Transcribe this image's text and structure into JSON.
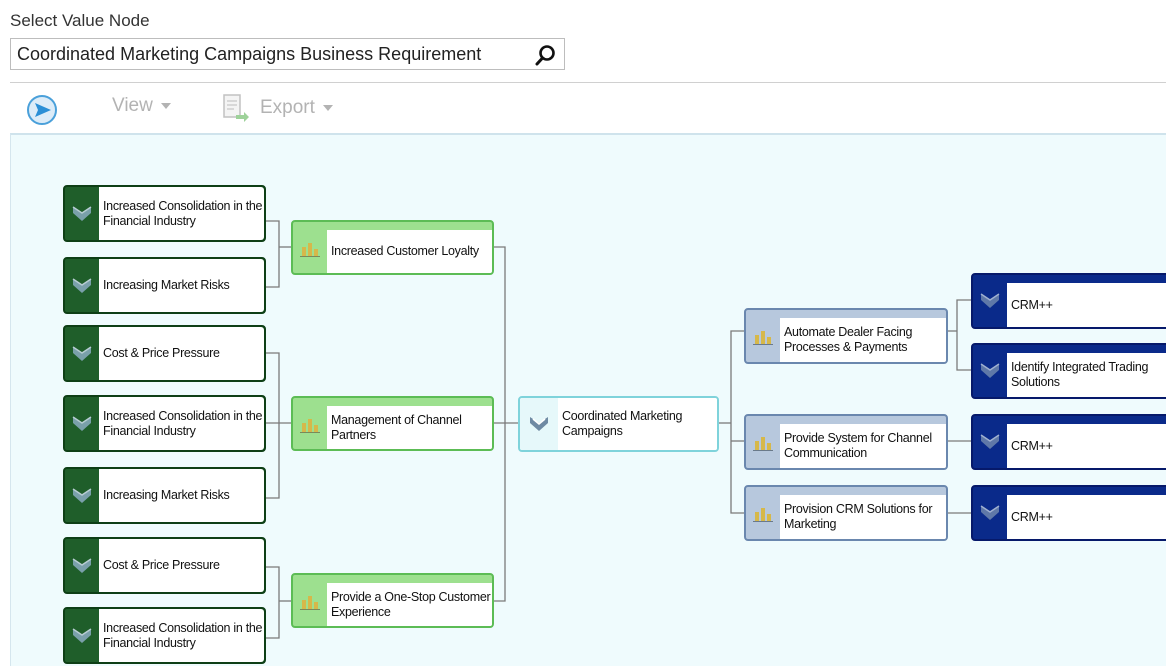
{
  "header": {
    "select_label": "Select Value Node",
    "search_value": "Coordinated Marketing Campaigns Business Requirement",
    "search_icon": "search-icon"
  },
  "toolbar": {
    "go_icon": "arrow-circle-icon",
    "view_label": "View",
    "export_label": "Export",
    "export_icon": "export-doc-icon"
  },
  "colors": {
    "dark_green": "#1f5e2a",
    "light_green": "#9de08f",
    "teal_center": "#7fd3db",
    "slate_blue": "#b7c8dd",
    "navy": "#0a2a8a",
    "canvas_bg": "#effbfd"
  },
  "tree": {
    "drivers": [
      {
        "label": "Increased Consolidation in the Financial Industry"
      },
      {
        "label": "Increasing Market Risks"
      },
      {
        "label": "Cost & Price Pressure"
      },
      {
        "label": "Increased Consolidation in the Financial Industry"
      },
      {
        "label": "Increasing Market Risks"
      },
      {
        "label": "Cost & Price Pressure"
      },
      {
        "label": "Increased Consolidation in the Financial Industry"
      }
    ],
    "objectives": [
      {
        "label": "Increased Customer Loyalty"
      },
      {
        "label": "Management of Channel Partners"
      },
      {
        "label": "Provide a One-Stop Customer Experience"
      }
    ],
    "center": {
      "label": "Coordinated Marketing Campaigns"
    },
    "requirements": [
      {
        "label": "Automate Dealer Facing Processes & Payments"
      },
      {
        "label": "Provide System for Channel Communication"
      },
      {
        "label": "Provision CRM Solutions for Marketing"
      }
    ],
    "solutions": [
      {
        "label": "CRM++"
      },
      {
        "label": "Identify Integrated Trading Solutions"
      },
      {
        "label": "CRM++"
      },
      {
        "label": "CRM++"
      }
    ]
  }
}
